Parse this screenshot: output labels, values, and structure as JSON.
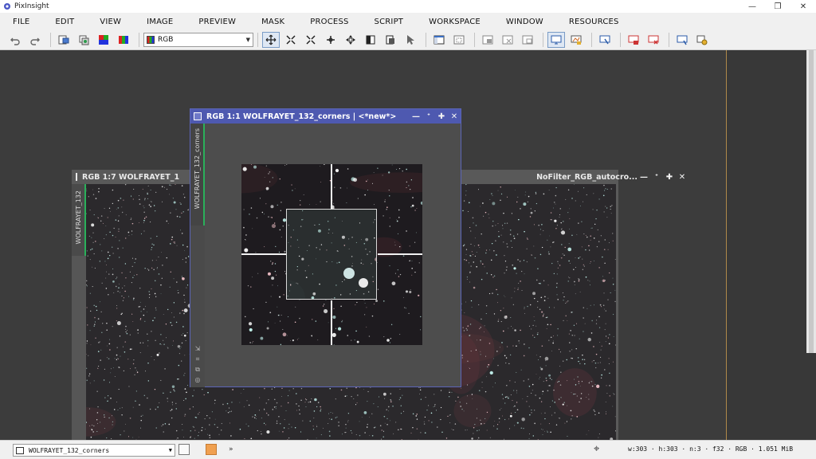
{
  "app": {
    "title": "PixInsight",
    "window_controls": {
      "minimize": "—",
      "restore": "❐",
      "close": "✕"
    }
  },
  "menu": [
    "FILE",
    "EDIT",
    "VIEW",
    "IMAGE",
    "PREVIEW",
    "MASK",
    "PROCESS",
    "SCRIPT",
    "WORKSPACE",
    "WINDOW",
    "RESOURCES"
  ],
  "toolbar": {
    "channel_select": "RGB",
    "groups": [
      [
        "undo-icon",
        "redo-icon"
      ],
      [
        "new-image-icon",
        "duplicate-icon",
        "image-copy-icon",
        "image-extract-icon"
      ],
      [
        "pan-mode-icon",
        "zoom-fit-icon",
        "zoom-out-icon",
        "zoom-in-icon",
        "move-icon",
        "view-icon",
        "copy-view-icon",
        "pointer-icon"
      ],
      [
        "window-list-icon",
        "preview-icon"
      ],
      [
        "preview-new-icon",
        "preview-delete-icon",
        "preview-copy-icon"
      ],
      [
        "monitor-icon",
        "stf-icon"
      ],
      [
        "display-add-icon"
      ],
      [
        "display-remove-icon",
        "display-close-icon"
      ],
      [
        "screen-icon",
        "process-icon"
      ]
    ]
  },
  "windows": {
    "back": {
      "title_left": "RGB 1:7 WOLFRAYET_1",
      "title_right": "NoFilter_RGB_autocro...",
      "side_label": "WOLFRAYET_132",
      "controls": {
        "minimize": "—",
        "shade": "ᐩ",
        "maximize": "✚",
        "close": "✕"
      }
    },
    "front": {
      "title": "RGB 1:1 WOLFRAYET_132_corners | <*new*>",
      "side_label": "WOLFRAYET_132_corners",
      "controls": {
        "minimize": "—",
        "shade": "ᐩ",
        "maximize": "✚",
        "close": "✕"
      }
    }
  },
  "statusbar": {
    "view_select": "WOLFRAYET_132_corners",
    "more": "»",
    "info": "w:303 · h:303 · n:3 · f32 · RGB · 1.051 MiB"
  },
  "colors": {
    "workspace": "#3c3c3c",
    "front_title": "#4e59b0",
    "back_title": "#595959",
    "accent_green": "#2ab05a",
    "status_color": "#f0a050"
  }
}
